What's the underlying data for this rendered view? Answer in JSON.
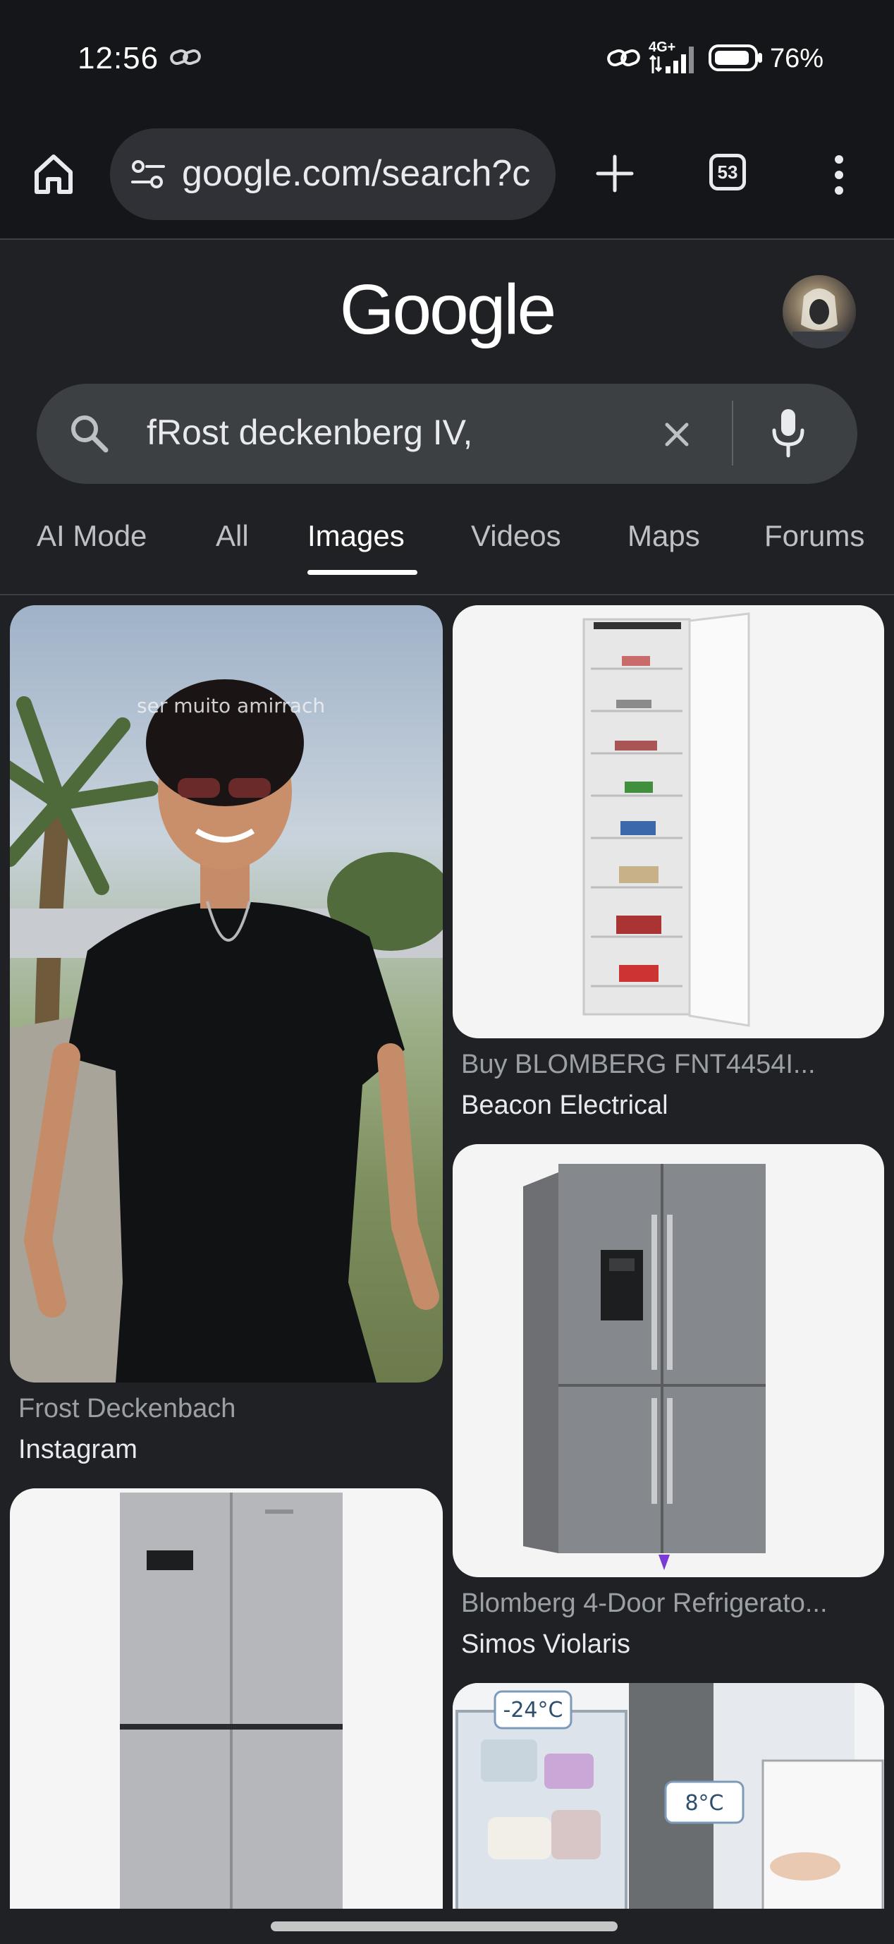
{
  "status_bar": {
    "time": "12:56",
    "network": "4G+",
    "battery": "76%",
    "icons": [
      "link-icon",
      "hotspot-icon",
      "signal-icon",
      "battery-icon"
    ]
  },
  "browser": {
    "url": "google.com/search?c",
    "tab_count": "53",
    "icons": [
      "home-icon",
      "site-settings-icon",
      "new-tab-icon",
      "tab-switcher-icon",
      "overflow-menu-icon"
    ]
  },
  "google": {
    "logo": "Google",
    "query": "fRost deckenberg IV,",
    "icons": [
      "search-icon",
      "clear-icon",
      "microphone-icon"
    ]
  },
  "tabs": [
    "AI Mode",
    "All",
    "Images",
    "Videos",
    "Maps",
    "Forums"
  ],
  "active_tab": "Images",
  "results": [
    {
      "title": "Frost Deckenbach",
      "source": "Instagram"
    },
    {
      "title": "Buy BLOMBERG FNT4454I...",
      "source": "Beacon Electrical"
    },
    {
      "title": "Blomberg 4-Door Refrigerato...",
      "source": "Simos Violaris"
    },
    {
      "title": "",
      "source": ""
    },
    {
      "title": "",
      "source": ""
    }
  ],
  "image_overlay_text": {
    "person_caption": "ser muito amirrach",
    "freezer_temp": "-24°C",
    "fridge_temp": "8°C"
  }
}
